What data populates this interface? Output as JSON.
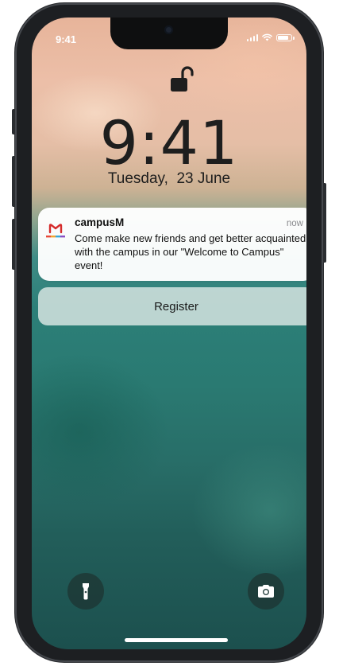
{
  "status_bar": {
    "time": "9:41",
    "icons": [
      "signal-icon",
      "wifi-icon",
      "battery-icon"
    ]
  },
  "lock_screen": {
    "lock_icon": "unlocked-padlock-icon",
    "clock": "9:41",
    "date": "Tuesday,  23 June"
  },
  "notification": {
    "app_icon": "campusM-logo-icon",
    "app_name": "campusM",
    "time": "now",
    "body": "Come make new friends and get better acquainted with the campus in our \"Welcome to Campus\" event!",
    "action_label": "Register"
  },
  "quick_actions": {
    "left_icon": "flashlight-icon",
    "right_icon": "camera-icon"
  },
  "colors": {
    "brand_red": "#d52b2b",
    "notification_bg": "#ffffff",
    "text_dark": "#1e1e1e"
  }
}
